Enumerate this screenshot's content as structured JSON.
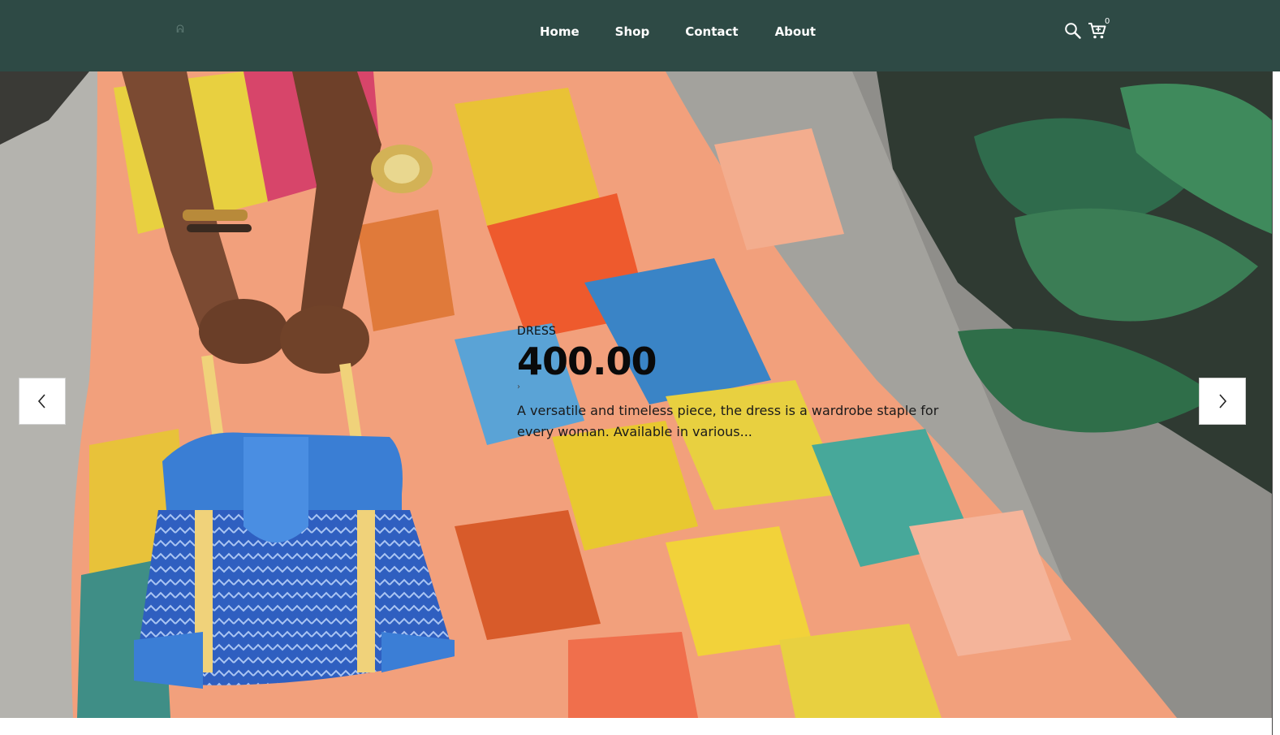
{
  "header": {
    "logo_glyph": "ᕱ",
    "nav": [
      "Home",
      "Shop",
      "Contact",
      "About"
    ],
    "cart_count": "0",
    "icons": {
      "search": "search-icon",
      "cart": "cart-icon"
    },
    "background_color": "#2e4a45"
  },
  "hero": {
    "category": "DRESS",
    "price": "400.00",
    "bullet": "›",
    "description": "A versatile and timeless piece, the dress is a wardrobe staple for every woman. Available in various...",
    "prev_icon": "chevron-left-icon",
    "next_icon": "chevron-right-icon"
  }
}
